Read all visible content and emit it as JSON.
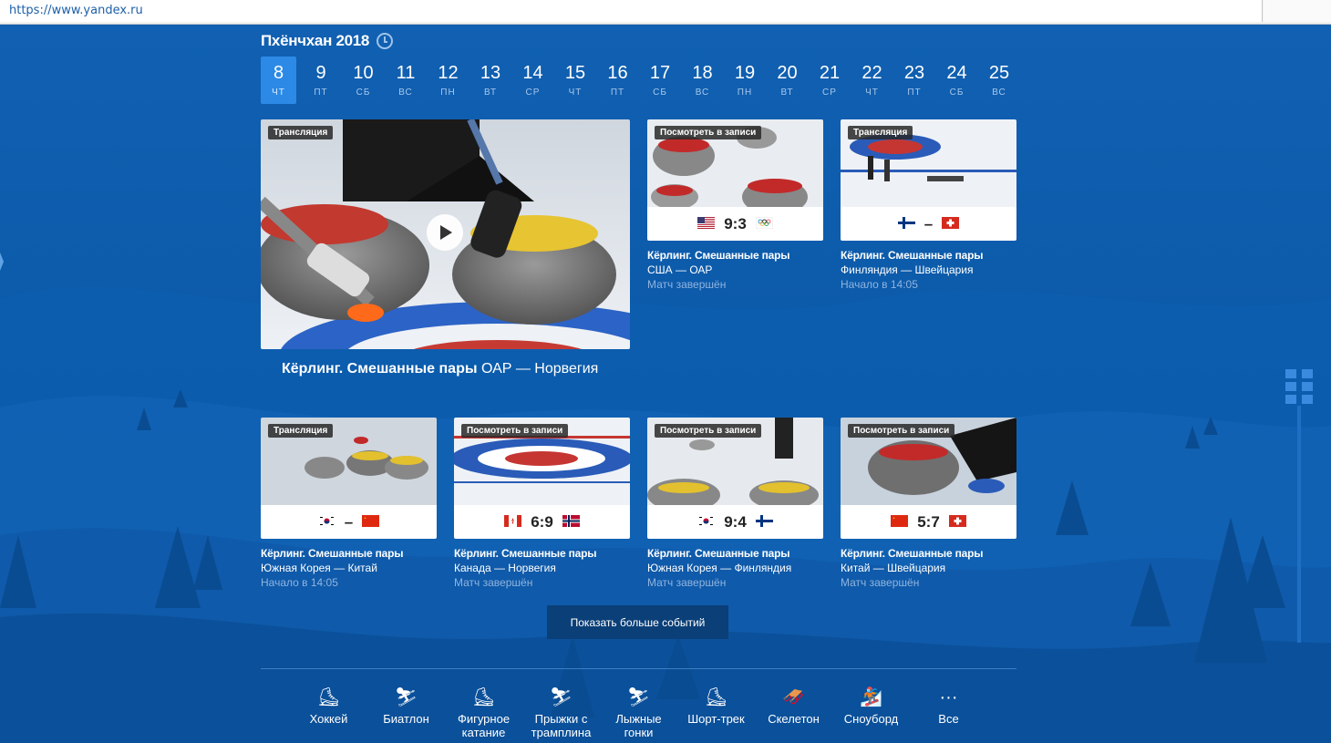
{
  "browser": {
    "url": "https://www.yandex.ru"
  },
  "header": {
    "title": "Пхёнчхан 2018"
  },
  "days": [
    {
      "num": "8",
      "wd": "ЧТ",
      "active": true
    },
    {
      "num": "9",
      "wd": "ПТ"
    },
    {
      "num": "10",
      "wd": "СБ"
    },
    {
      "num": "11",
      "wd": "ВС"
    },
    {
      "num": "12",
      "wd": "ПН"
    },
    {
      "num": "13",
      "wd": "ВТ"
    },
    {
      "num": "14",
      "wd": "СР"
    },
    {
      "num": "15",
      "wd": "ЧТ"
    },
    {
      "num": "16",
      "wd": "ПТ"
    },
    {
      "num": "17",
      "wd": "СБ"
    },
    {
      "num": "18",
      "wd": "ВС"
    },
    {
      "num": "19",
      "wd": "ПН"
    },
    {
      "num": "20",
      "wd": "ВТ"
    },
    {
      "num": "21",
      "wd": "СР"
    },
    {
      "num": "22",
      "wd": "ЧТ"
    },
    {
      "num": "23",
      "wd": "ПТ"
    },
    {
      "num": "24",
      "wd": "СБ"
    },
    {
      "num": "25",
      "wd": "ВС"
    }
  ],
  "featured": {
    "badge": "Трансляция",
    "title": "Кёрлинг. Смешанные пары",
    "teams": "ОАР — Норвегия"
  },
  "cards_top": [
    {
      "badge": "Посмотреть в записи",
      "score": "9:3",
      "title": "Кёрлинг. Смешанные пары",
      "teams": "США — ОАР",
      "status": "Матч завершён"
    },
    {
      "badge": "Трансляция",
      "score": "–",
      "title": "Кёрлинг. Смешанные пары",
      "teams": "Финляндия — Швейцария",
      "status": "Начало в 14:05"
    }
  ],
  "cards_bottom": [
    {
      "badge": "Трансляция",
      "score": "–",
      "title": "Кёрлинг. Смешанные пары",
      "teams": "Южная Корея — Китай",
      "status": "Начало в 14:05"
    },
    {
      "badge": "Посмотреть в записи",
      "score": "6:9",
      "title": "Кёрлинг. Смешанные пары",
      "teams": "Канада — Норвегия",
      "status": "Матч завершён"
    },
    {
      "badge": "Посмотреть в записи",
      "score": "9:4",
      "title": "Кёрлинг. Смешанные пары",
      "teams": "Южная Корея — Финляндия",
      "status": "Матч завершён"
    },
    {
      "badge": "Посмотреть в записи",
      "score": "5:7",
      "title": "Кёрлинг. Смешанные пары",
      "teams": "Китай — Швейцария",
      "status": "Матч завершён"
    }
  ],
  "more_button": "Показать больше событий",
  "sports": [
    {
      "label": "Хоккей",
      "icon": "hockey-icon",
      "glyph": "⛸"
    },
    {
      "label": "Биатлон",
      "icon": "biathlon-icon",
      "glyph": "⛷"
    },
    {
      "label": "Фигурное катание",
      "icon": "figure-skating-icon",
      "glyph": "⛸"
    },
    {
      "label": "Прыжки с трамплина",
      "icon": "ski-jumping-icon",
      "glyph": "⛷"
    },
    {
      "label": "Лыжные гонки",
      "icon": "cross-country-icon",
      "glyph": "⛷"
    },
    {
      "label": "Шорт-трек",
      "icon": "short-track-icon",
      "glyph": "⛸"
    },
    {
      "label": "Скелетон",
      "icon": "skeleton-icon",
      "glyph": "🛷"
    },
    {
      "label": "Сноуборд",
      "icon": "snowboard-icon",
      "glyph": "🏂"
    },
    {
      "label": "Все",
      "icon": "more-icon",
      "glyph": "···"
    }
  ],
  "colors": {
    "accent": "#2c8ae6",
    "background": "#0d5aa8",
    "button": "#0b3f78"
  }
}
